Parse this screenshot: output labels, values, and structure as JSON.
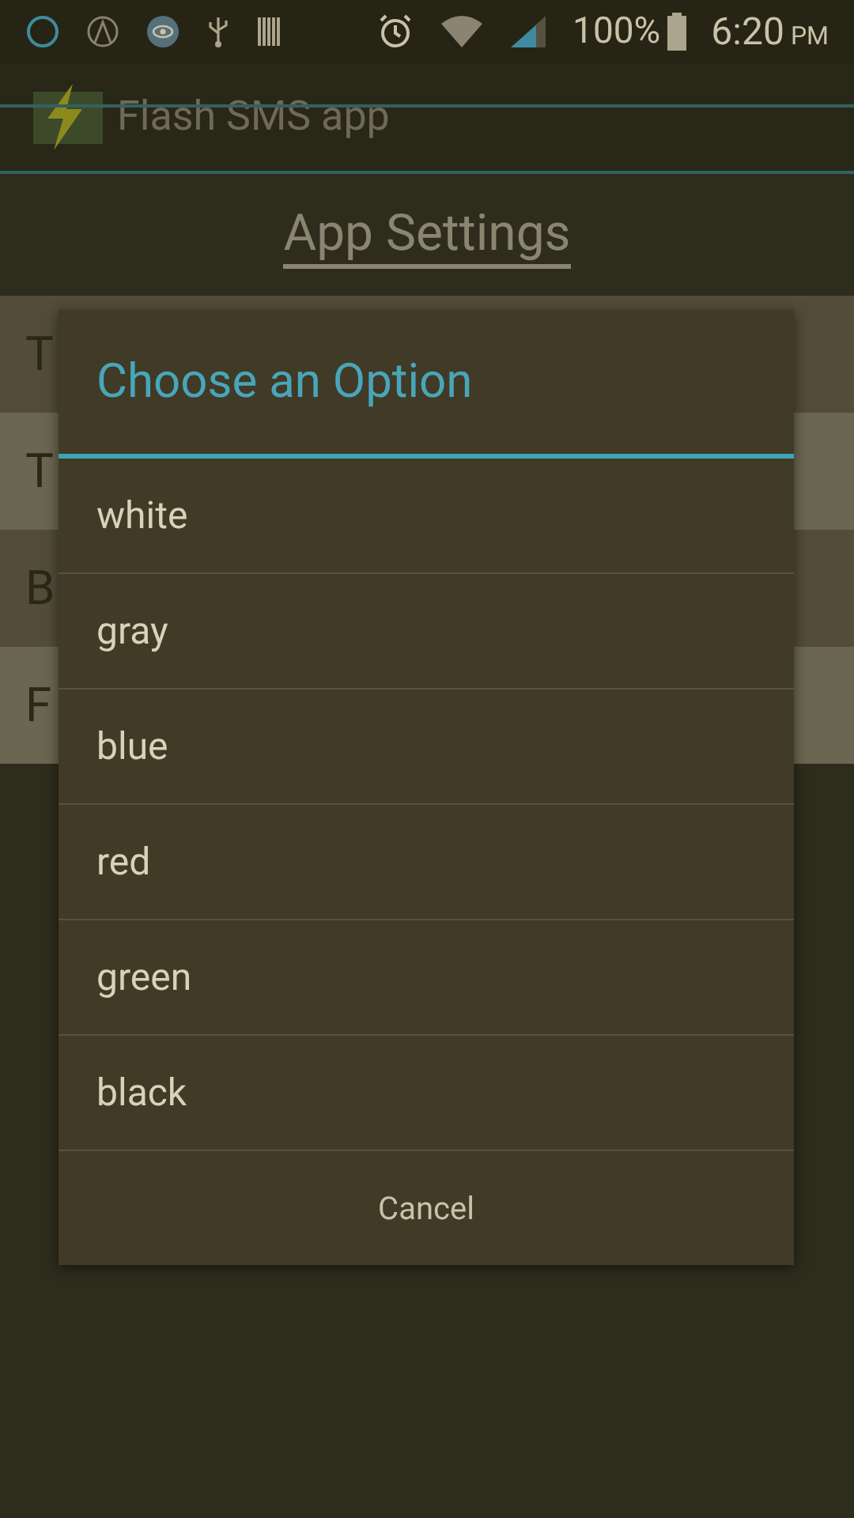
{
  "status_bar": {
    "battery": "100%",
    "time": "6:20",
    "ampm": "PM"
  },
  "app_bar": {
    "title": "Flash SMS app"
  },
  "page_title": "App Settings",
  "settings_rows": [
    {
      "label": "T",
      "color": "#524c39"
    },
    {
      "label": "T",
      "color": "#6b6651"
    },
    {
      "label": "B",
      "color": "#524c39"
    },
    {
      "label": "F",
      "color": "#6b6651"
    }
  ],
  "dialog": {
    "title": "Choose an Option",
    "options": [
      "white",
      "gray",
      "blue",
      "red",
      "green",
      "black"
    ],
    "cancel": "Cancel"
  }
}
